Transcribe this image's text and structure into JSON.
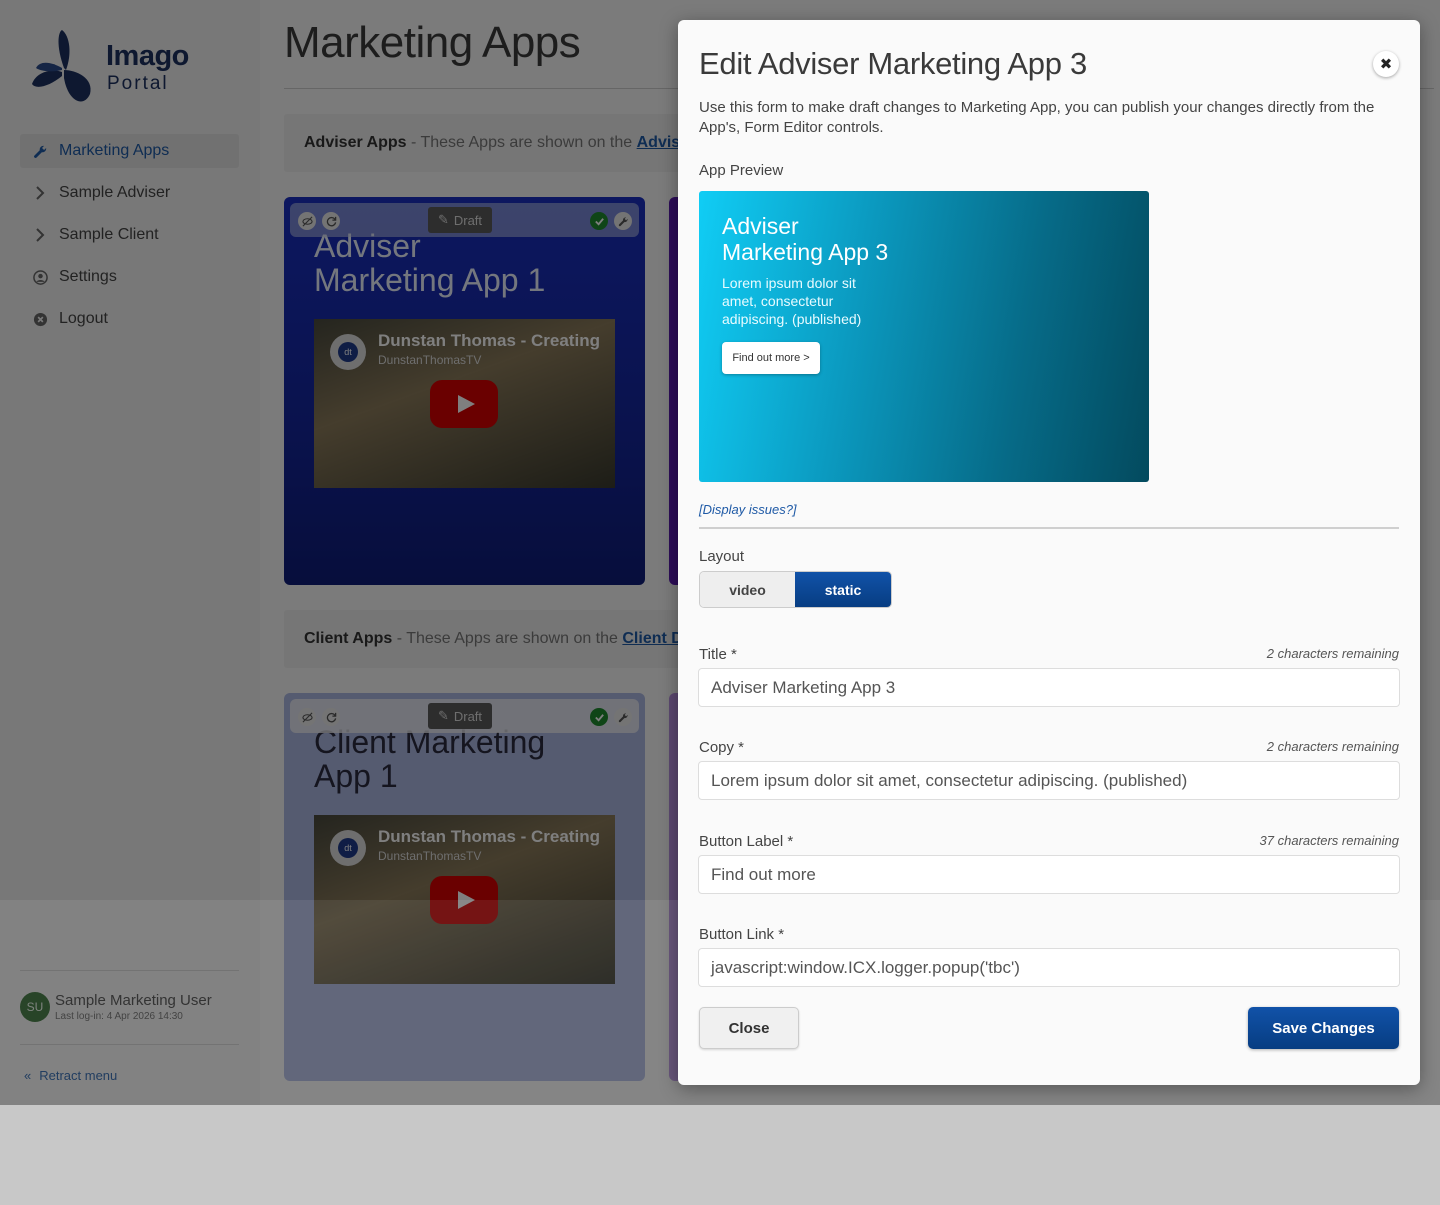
{
  "sidebar": {
    "logo": {
      "line1": "Imago",
      "line2": "Portal"
    },
    "items": [
      {
        "label": "Marketing Apps",
        "icon": "wrench-icon",
        "active": true
      },
      {
        "label": "Sample Adviser",
        "icon": "chevron-right-icon",
        "active": false
      },
      {
        "label": "Sample Client",
        "icon": "chevron-right-icon",
        "active": false
      },
      {
        "label": "Settings",
        "icon": "user-circle-icon",
        "active": false
      },
      {
        "label": "Logout",
        "icon": "close-circle-icon",
        "active": false
      }
    ],
    "user": {
      "initials": "SU",
      "name": "Sample Marketing User",
      "last_login": "Last log-in: 4 Apr 2026 14:30"
    },
    "retract_label": "Retract menu"
  },
  "main": {
    "title": "Marketing Apps",
    "adviser_section": {
      "bold": "Adviser Apps",
      "text": " - These Apps are shown on the ",
      "link": "Adviser"
    },
    "client_section": {
      "bold": "Client Apps",
      "text": " - These Apps are shown on the ",
      "link": "Client Da"
    },
    "cards": [
      {
        "title_line1": "Adviser",
        "title_line2": "Marketing App 1",
        "draft_label": "Draft",
        "video": {
          "title": "Dunstan Thomas - Creating",
          "channel": "DunstanThomasTV",
          "channel_initials": "dt"
        },
        "color": "#1a2fa8"
      },
      {
        "title_line1": "Client Marketing",
        "title_line2": "App 1",
        "draft_label": "Draft",
        "video": {
          "title": "Dunstan Thomas - Creating",
          "channel": "DunstanThomasTV",
          "channel_initials": "dt"
        },
        "color": "#a9b8e8"
      }
    ]
  },
  "modal": {
    "title": "Edit Adviser Marketing App 3",
    "description": "Use this form to make draft changes to Marketing App, you can publish your changes directly from the App's, Form Editor controls.",
    "preview_label": "App Preview",
    "preview": {
      "title_line1": "Adviser",
      "title_line2": "Marketing App 3",
      "copy": "Lorem ipsum dolor sit amet, consectetur adipiscing. (published)",
      "button": "Find out more >"
    },
    "display_issues": "[Display issues?]",
    "layout_label": "Layout",
    "layout_options": [
      "video",
      "static"
    ],
    "layout_selected": "static",
    "fields": {
      "title": {
        "label": "Title *",
        "remaining": "2 characters remaining",
        "value": "Adviser Marketing App 3"
      },
      "copy": {
        "label": "Copy *",
        "remaining": "2 characters remaining",
        "value": "Lorem ipsum dolor sit amet, consectetur adipiscing. (published)"
      },
      "button_label": {
        "label": "Button Label *",
        "remaining": "37 characters remaining",
        "value": "Find out more"
      },
      "button_link": {
        "label": "Button Link *",
        "value": "javascript:window.ICX.logger.popup('tbc')"
      }
    },
    "close_label": "Close",
    "save_label": "Save Changes"
  }
}
